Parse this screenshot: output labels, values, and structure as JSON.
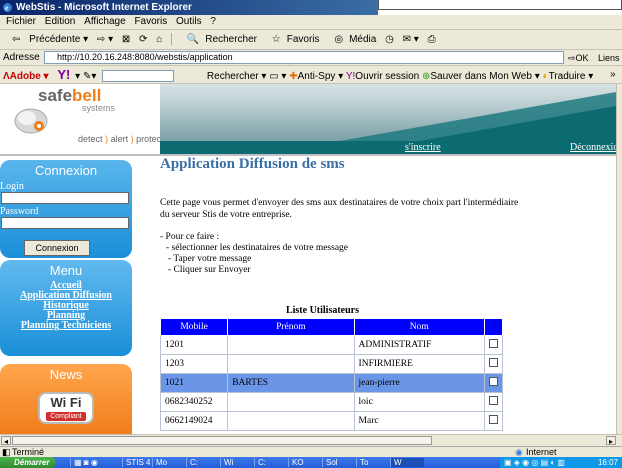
{
  "window": {
    "title": "WebStis - Microsoft Internet Explorer"
  },
  "menubar": {
    "items": [
      "Fichier",
      "Edition",
      "Affichage",
      "Favoris",
      "Outils",
      "?"
    ]
  },
  "toolbar": {
    "back": "Précédente",
    "search": "Rechercher",
    "favorites": "Favoris",
    "media": "Média"
  },
  "address": {
    "label": "Adresse",
    "url": "http://10.20.16.248:8080/webstis/application",
    "go": "OK",
    "links": "Liens"
  },
  "linksbar": {
    "adobe": "Adobe",
    "search_button": "Rechercher",
    "antispy": "Anti-Spy",
    "session": "Ouvrir session",
    "save": "Sauver dans Mon Web",
    "translate": "Traduire"
  },
  "logo": {
    "safe": "safe",
    "bell": "bell",
    "systems": "systems",
    "tagline_detect": "detect",
    "tagline_alert": "alert",
    "tagline_protect": "protect"
  },
  "header": {
    "inscrire": "s'inscrire",
    "deconnexion": "Déconnexion"
  },
  "connexion": {
    "title": "Connexion",
    "login_label": "Login",
    "password_label": "Password",
    "button": "Connexion"
  },
  "menu": {
    "title": "Menu",
    "links": [
      "Accueil",
      "Application Diffusion",
      "Historique",
      "Planning",
      "Planning Techniciens"
    ]
  },
  "news": {
    "title": "News",
    "wifi": "Wi Fi",
    "compliant": "Compliant"
  },
  "main": {
    "title": "Application Diffusion de sms",
    "intro_1": "Cette page vous permet d'envoyer des sms aux destinataires de votre choix part l'intermédiaire",
    "intro_2": "du serveur Stis de votre entreprise.",
    "steps_title": "- Pour ce faire :",
    "steps": [
      "- sélectionner les destinataires de votre message",
      "- Taper votre message",
      "- Cliquer sur Envoyer"
    ]
  },
  "users_table": {
    "caption": "Liste Utilisateurs",
    "headers": [
      "Mobile",
      "Prénom",
      "Nom"
    ],
    "rows": [
      {
        "mobile": "1201",
        "prenom": "",
        "nom": "ADMINISTRATIF",
        "selected": false
      },
      {
        "mobile": "1203",
        "prenom": "",
        "nom": "INFIRMIERE",
        "selected": false
      },
      {
        "mobile": "1021",
        "prenom": "BARTES",
        "nom": "jean-pierre",
        "selected": true
      },
      {
        "mobile": "0682340252",
        "prenom": "",
        "nom": "loic",
        "selected": false
      },
      {
        "mobile": "0662149024",
        "prenom": "",
        "nom": "Marc",
        "selected": false
      }
    ]
  },
  "status": {
    "left": "Terminé",
    "zone": "Internet"
  },
  "taskbar": {
    "start": "Démarrer",
    "tasks": [
      "STIS 4",
      "Mo",
      "C:",
      "Wi",
      "C:",
      "KO",
      "Sol",
      "To",
      "W"
    ],
    "clock": "16:07"
  },
  "colors": {
    "header_blue": "#0000ff",
    "selected_row": "#6b96e8",
    "title_blue": "#3a6fa6",
    "brand_orange": "#f07d1a",
    "sidebar_blue": "#1a8fd8"
  }
}
